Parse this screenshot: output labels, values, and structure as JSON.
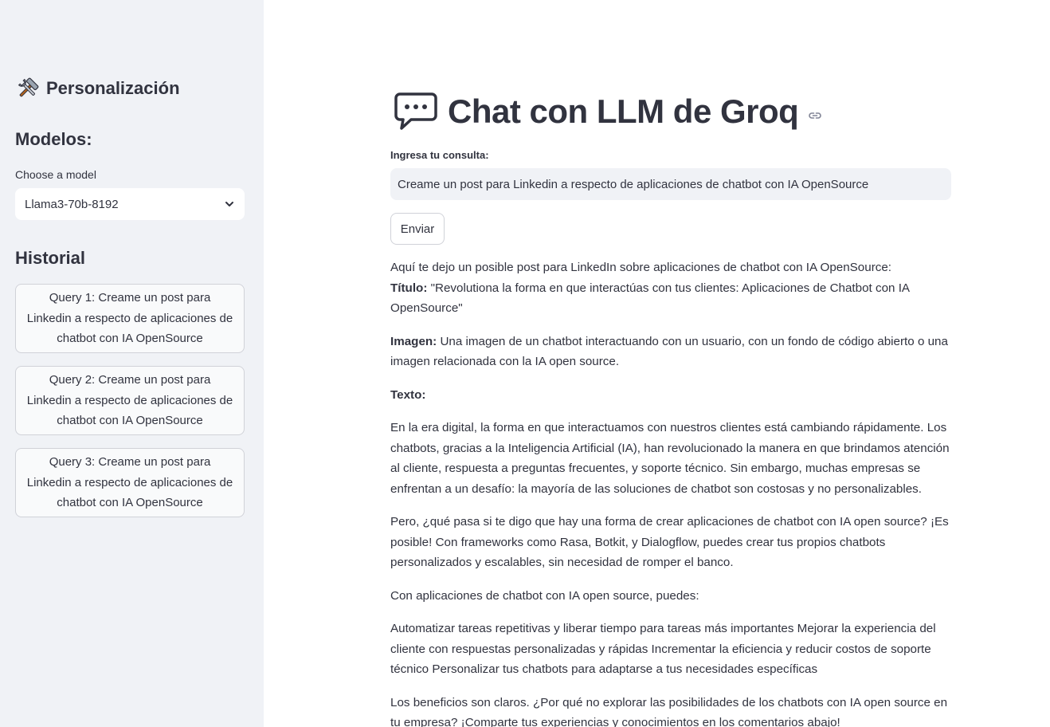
{
  "sidebar": {
    "title": "Personalización",
    "models_heading": "Modelos:",
    "model_select": {
      "label": "Choose a model",
      "value": "Llama3-70b-8192"
    },
    "history_heading": "Historial",
    "history": [
      {
        "label": "Query 1: Creame un post para Linkedin a respecto de aplicaciones de chatbot con IA OpenSource"
      },
      {
        "label": "Query 2: Creame un post para Linkedin a respecto de aplicaciones de chatbot con IA OpenSource"
      },
      {
        "label": "Query 3: Creame un post para Linkedin a respecto de aplicaciones de chatbot con IA OpenSource"
      }
    ]
  },
  "main": {
    "title": "Chat con LLM de Groq",
    "input_label": "Ingresa tu consulta:",
    "input_value": "Creame un post para Linkedin a respecto de aplicaciones de chatbot con IA OpenSource",
    "send_label": "Enviar",
    "response": {
      "intro": "Aquí te dejo un posible post para LinkedIn sobre aplicaciones de chatbot con IA OpenSource:",
      "title_label": "Título:",
      "title_text": " \"Revolutiona la forma en que interactúas con tus clientes: Aplicaciones de Chatbot con IA OpenSource\"",
      "image_label": "Imagen:",
      "image_text": " Una imagen de un chatbot interactuando con un usuario, con un fondo de código abierto o una imagen relacionada con la IA open source.",
      "text_label": "Texto:",
      "p1": "En la era digital, la forma en que interactuamos con nuestros clientes está cambiando rápidamente. Los chatbots, gracias a la Inteligencia Artificial (IA), han revolucionado la manera en que brindamos atención al cliente, respuesta a preguntas frecuentes, y soporte técnico. Sin embargo, muchas empresas se enfrentan a un desafío: la mayoría de las soluciones de chatbot son costosas y no personalizables.",
      "p2": "Pero, ¿qué pasa si te digo que hay una forma de crear aplicaciones de chatbot con IA open source? ¡Es posible! Con frameworks como Rasa, Botkit, y Dialogflow, puedes crear tus propios chatbots personalizados y escalables, sin necesidad de romper el banco.",
      "p3": "Con aplicaciones de chatbot con IA open source, puedes:",
      "p4": "Automatizar tareas repetitivas y liberar tiempo para tareas más importantes Mejorar la experiencia del cliente con respuestas personalizadas y rápidas Incrementar la eficiencia y reducir costos de soporte técnico Personalizar tus chatbots para adaptarse a tus necesidades específicas",
      "p5": "Los beneficios son claros. ¿Por qué no explorar las posibilidades de los chatbots con IA open source en tu empresa? ¡Comparte tus experiencias y conocimientos en los comentarios abajo!"
    }
  },
  "icons": {
    "sidebar_title": "tools-icon",
    "select_arrow": "chevron-down-icon",
    "title": "speech-bubble-icon",
    "anchor": "link-icon"
  }
}
